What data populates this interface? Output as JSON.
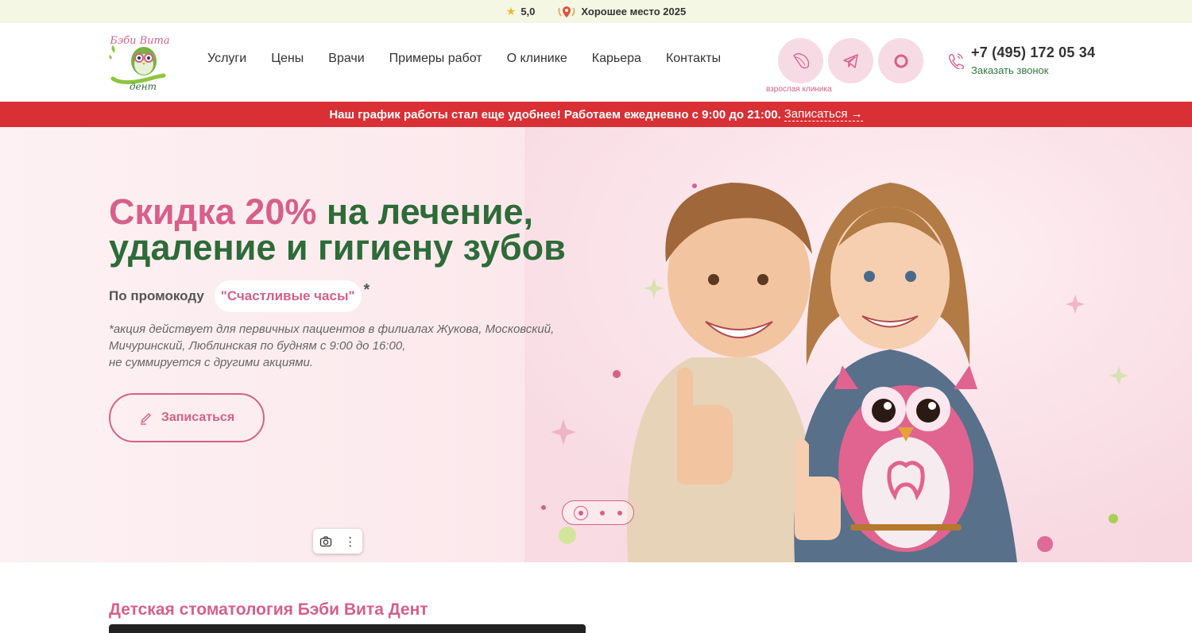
{
  "topbar": {
    "rating": "5,0",
    "award": "Хорошее место 2025"
  },
  "logo": {
    "text_top": "Бэби Вита",
    "text_bottom": "дент"
  },
  "nav": {
    "items": [
      "Услуги",
      "Цены",
      "Врачи",
      "Примеры работ",
      "О клинике",
      "Карьера",
      "Контакты"
    ]
  },
  "header": {
    "adult_clinic_label": "взрослая клиника",
    "phone": "+7 (495) 172 05 34",
    "callback": "Заказать звонок"
  },
  "banner": {
    "text": "Наш график работы стал еще удобнее! Работаем ежедневно с 9:00 до 21:00.",
    "link": "Записаться →"
  },
  "hero": {
    "title_pink": "Скидка 20%",
    "title_green_1": "на лечение,",
    "title_green_2": "удаление и гигиену зубов",
    "promo_label": "По промокоду",
    "promo_code": "\"Счастливые часы\"",
    "asterisk": "*",
    "note_1": "*акция действует для первичных пациентов в филиалах Жукова, Московский,",
    "note_2": "Мичуринский, Люблинская по будням с 9:00 до 16:00,",
    "note_3": "не суммируется с другими акциями.",
    "cta": "Записаться"
  },
  "slider": {
    "current": 1,
    "total": 3
  },
  "section": {
    "subtitle": "Детская стоматология Бэби Вита Дент"
  },
  "colors": {
    "pink": "#d6608a",
    "green": "#2d6b38",
    "red": "#d93035",
    "topbar_bg": "#f3f7e4"
  }
}
